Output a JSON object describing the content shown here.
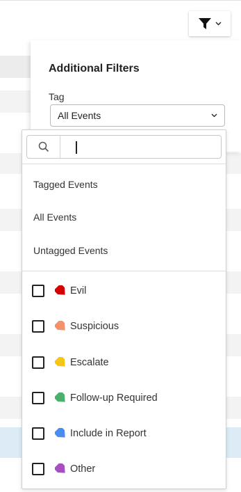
{
  "filter_button": {
    "icon": "filter-icon",
    "chevron": "chevron-down-icon"
  },
  "panel": {
    "title": "Additional Filters",
    "tag_label": "Tag",
    "tag_select_value": "All Events"
  },
  "dropdown": {
    "search_value": "",
    "options": [
      {
        "label": "Tagged Events"
      },
      {
        "label": "All Events"
      },
      {
        "label": "Untagged Events"
      }
    ],
    "tags": [
      {
        "label": "Evil",
        "color": "#d50000",
        "checked": false
      },
      {
        "label": "Suspicious",
        "color": "#f4906b",
        "checked": false
      },
      {
        "label": "Escalate",
        "color": "#f5c518",
        "checked": false
      },
      {
        "label": "Follow-up Required",
        "color": "#4caf6b",
        "checked": false
      },
      {
        "label": "Include in Report",
        "color": "#4a8cf0",
        "checked": false
      },
      {
        "label": "Other",
        "color": "#a64fc0",
        "checked": false
      }
    ]
  },
  "colors": {
    "accent_row": "#dcebf5",
    "stripe": "#f1f1f1"
  }
}
